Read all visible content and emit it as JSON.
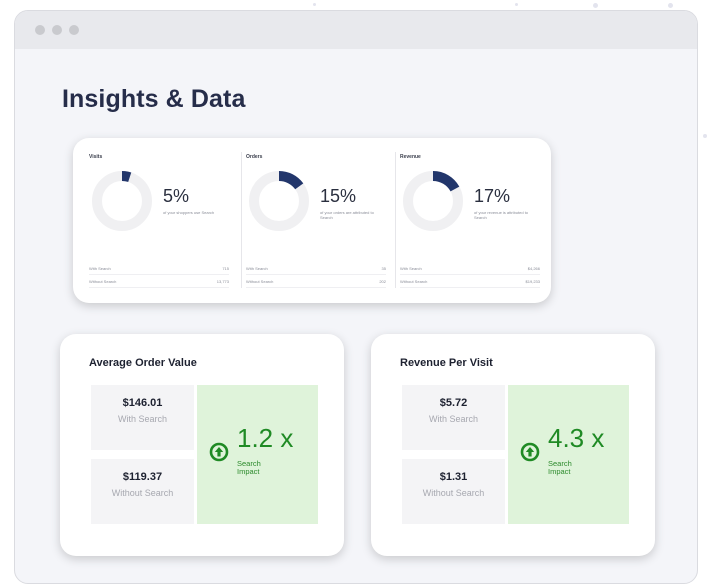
{
  "page": {
    "title": "Insights & Data"
  },
  "colors": {
    "accent": "#22366b",
    "ring": "#f0f0f2",
    "impact_bg": "#dff3da",
    "impact_text": "#1f8a24"
  },
  "metrics": [
    {
      "label": "Visits",
      "percent": "5%",
      "percent_value": 5,
      "description": "of your shoppers use Search",
      "rows": [
        {
          "label": "With Search",
          "value": "715"
        },
        {
          "label": "Without Search",
          "value": "13,773"
        }
      ]
    },
    {
      "label": "Orders",
      "percent": "15%",
      "percent_value": 15,
      "description": "of your orders are attributed to Search",
      "rows": [
        {
          "label": "With Search",
          "value": "35"
        },
        {
          "label": "Without Search",
          "value": "202"
        }
      ]
    },
    {
      "label": "Revenue",
      "percent": "17%",
      "percent_value": 17,
      "description": "of your revenue is attributed to Search",
      "rows": [
        {
          "label": "With Search",
          "value": "$4,266"
        },
        {
          "label": "Without Search",
          "value": "$19,233"
        }
      ]
    }
  ],
  "impacts": [
    {
      "title": "Average Order Value",
      "with_value": "$146.01",
      "with_label": "With Search",
      "without_value": "$119.37",
      "without_label": "Without Search",
      "impact_value": "1.2",
      "impact_unit": "x",
      "impact_label": "Search Impact",
      "icon": "arrow-up-circle-icon"
    },
    {
      "title": "Revenue Per Visit",
      "with_value": "$5.72",
      "with_label": "With Search",
      "without_value": "$1.31",
      "without_label": "Without Search",
      "impact_value": "4.3",
      "impact_unit": "x",
      "impact_label": "Search Impact",
      "icon": "arrow-up-circle-icon"
    }
  ]
}
